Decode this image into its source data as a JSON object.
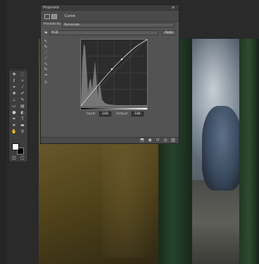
{
  "properties_panel": {
    "title": "Proprietà",
    "menu_icon": "panel-menu-icon",
    "tab_label": "Curve",
    "preset_label": "Predefinito:",
    "preset_value": "Personale",
    "channel_value": "RGB",
    "auto_label": "Auto",
    "input_label": "Input:",
    "input_value": "160",
    "output_label": "Output:",
    "output_value": "184",
    "curve_tools": [
      "pointer-icon",
      "pencil-sample-icon",
      "eyedropper-black-icon",
      "eyedropper-gray-icon",
      "eyedropper-white-icon",
      "curve-edit-icon",
      "pencil-icon",
      "smooth-icon",
      "warning-icon"
    ],
    "footer_icons": [
      "clip-icon",
      "view-previous-icon",
      "reset-icon",
      "visibility-icon",
      "trash-icon"
    ]
  },
  "tools_panel": {
    "tools": [
      "move-icon",
      "marquee-icon",
      "lasso-icon",
      "quick-select-icon",
      "crop-icon",
      "eyedropper-icon",
      "spot-heal-icon",
      "brush-icon",
      "clone-stamp-icon",
      "history-brush-icon",
      "eraser-icon",
      "gradient-icon",
      "blur-icon",
      "dodge-icon",
      "pen-icon",
      "type-icon",
      "path-select-icon",
      "shape-icon",
      "hand-icon",
      "zoom-icon"
    ],
    "foreground_color": "#ffffff",
    "background_color": "#000000"
  },
  "colors": {
    "panel_bg": "#535353",
    "titlebar_bg": "#3c3c3c",
    "graph_bg": "#2c2c2c"
  }
}
